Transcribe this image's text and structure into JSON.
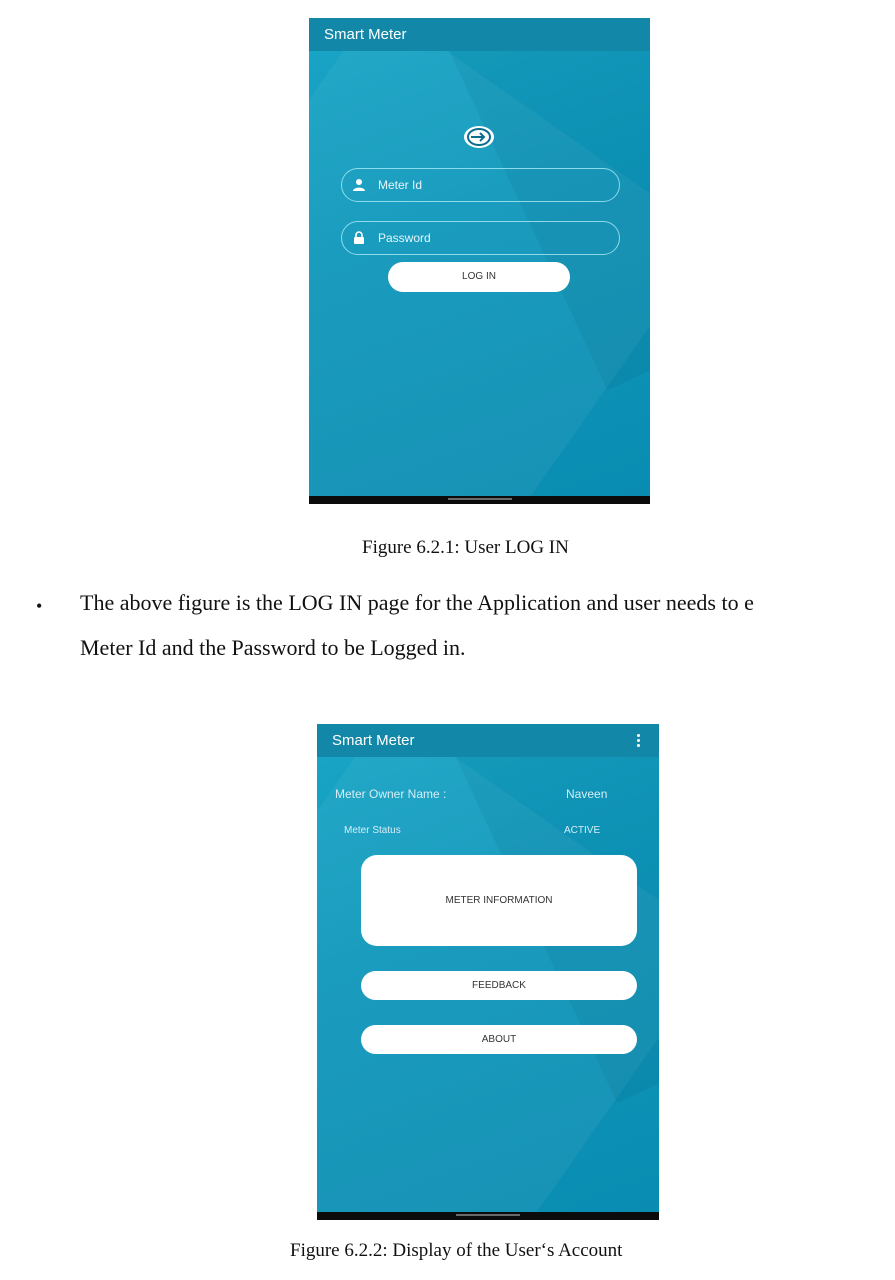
{
  "login_screen": {
    "app_title": "Smart Meter",
    "meter_id_placeholder": "Meter Id",
    "password_placeholder": "Password",
    "login_button": "LOG IN"
  },
  "figure1_caption": "Figure 6.2.1: User LOG IN",
  "paragraph": {
    "line1": "The above figure is the LOG IN page for the Application and user needs to e",
    "line2": "Meter Id and the Password to be Logged in."
  },
  "account_screen": {
    "app_title": "Smart Meter",
    "owner_label": "Meter Owner Name :",
    "owner_value": "Naveen",
    "status_label": "Meter Status",
    "status_value": "ACTIVE",
    "meter_info_button": "METER INFORMATION",
    "feedback_button": "FEEDBACK",
    "about_button": "ABOUT"
  },
  "figure2_caption": "Figure 6.2.2: Display of the User‘s Account"
}
